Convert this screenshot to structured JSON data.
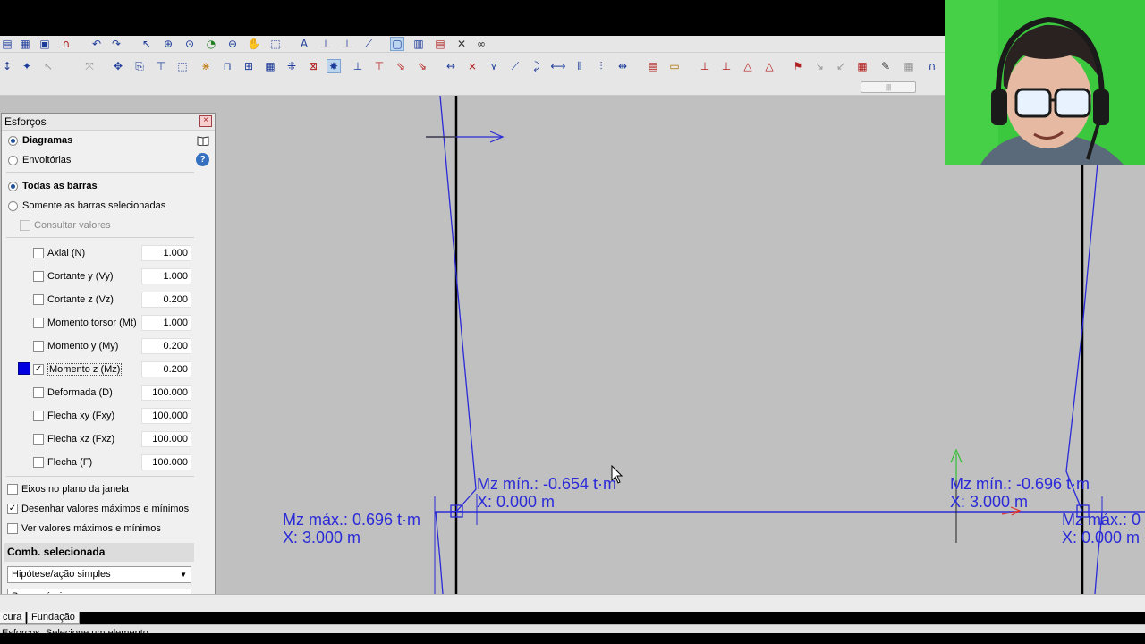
{
  "panel": {
    "title": "Esforços",
    "mode_options": [
      {
        "label": "Diagramas",
        "selected": true
      },
      {
        "label": "Envoltórias",
        "selected": false
      }
    ],
    "bar_options": [
      {
        "label": "Todas as barras",
        "selected": true
      },
      {
        "label": "Somente as barras selecionadas",
        "selected": false
      }
    ],
    "consult_label": "Consultar valores",
    "efforts": [
      {
        "label": "Axial (N)",
        "value": "1.000",
        "checked": false
      },
      {
        "label": "Cortante y (Vy)",
        "value": "1.000",
        "checked": false
      },
      {
        "label": "Cortante z (Vz)",
        "value": "0.200",
        "checked": false
      },
      {
        "label": "Momento torsor (Mt)",
        "value": "1.000",
        "checked": false
      },
      {
        "label": "Momento y (My)",
        "value": "0.200",
        "checked": false
      },
      {
        "label": "Momento z (Mz)",
        "value": "0.200",
        "checked": true,
        "color": "#0000e0"
      },
      {
        "label": "Deformada (D)",
        "value": "100.000",
        "checked": false
      },
      {
        "label": "Flecha xy (Fxy)",
        "value": "100.000",
        "checked": false
      },
      {
        "label": "Flecha xz (Fxz)",
        "value": "100.000",
        "checked": false
      },
      {
        "label": "Flecha (F)",
        "value": "100.000",
        "checked": false
      }
    ],
    "options": [
      {
        "label": "Eixos no plano da janela",
        "checked": false
      },
      {
        "label": "Desenhar valores máximos e mínimos",
        "checked": true
      },
      {
        "label": "Ver valores máximos e mínimos",
        "checked": false
      }
    ],
    "comb_header": "Comb. selecionada",
    "comb_type": "Hipótese/ação simples",
    "comb_case": "Peso próprio",
    "icons": {
      "book": "book-icon",
      "help": "help-icon",
      "help_glyph": "?"
    }
  },
  "diagram": {
    "labels": [
      {
        "line1": "Mz mín.: -0.654 t·m",
        "line2": "X: 0.000 m"
      },
      {
        "line1": "Mz máx.: 0.696 t·m",
        "line2": "X: 3.000 m"
      },
      {
        "line1": "Mz mín.: -0.696 t·m",
        "line2": "X: 3.000 m"
      },
      {
        "line1": "Mz máx.: 0",
        "line2": "X: 0.000 m"
      }
    ],
    "diagram_color": "#2a2ad8",
    "bar_color": "#000000"
  },
  "tabs": [
    "cura",
    "Fundação"
  ],
  "status_text": "Esforços. Selecione um elemento",
  "toolbar_icons": [
    "save-icon",
    "undo-icon",
    "redo-icon",
    "zoom-icon",
    "pan-icon",
    "select-icon",
    "delete-icon"
  ]
}
